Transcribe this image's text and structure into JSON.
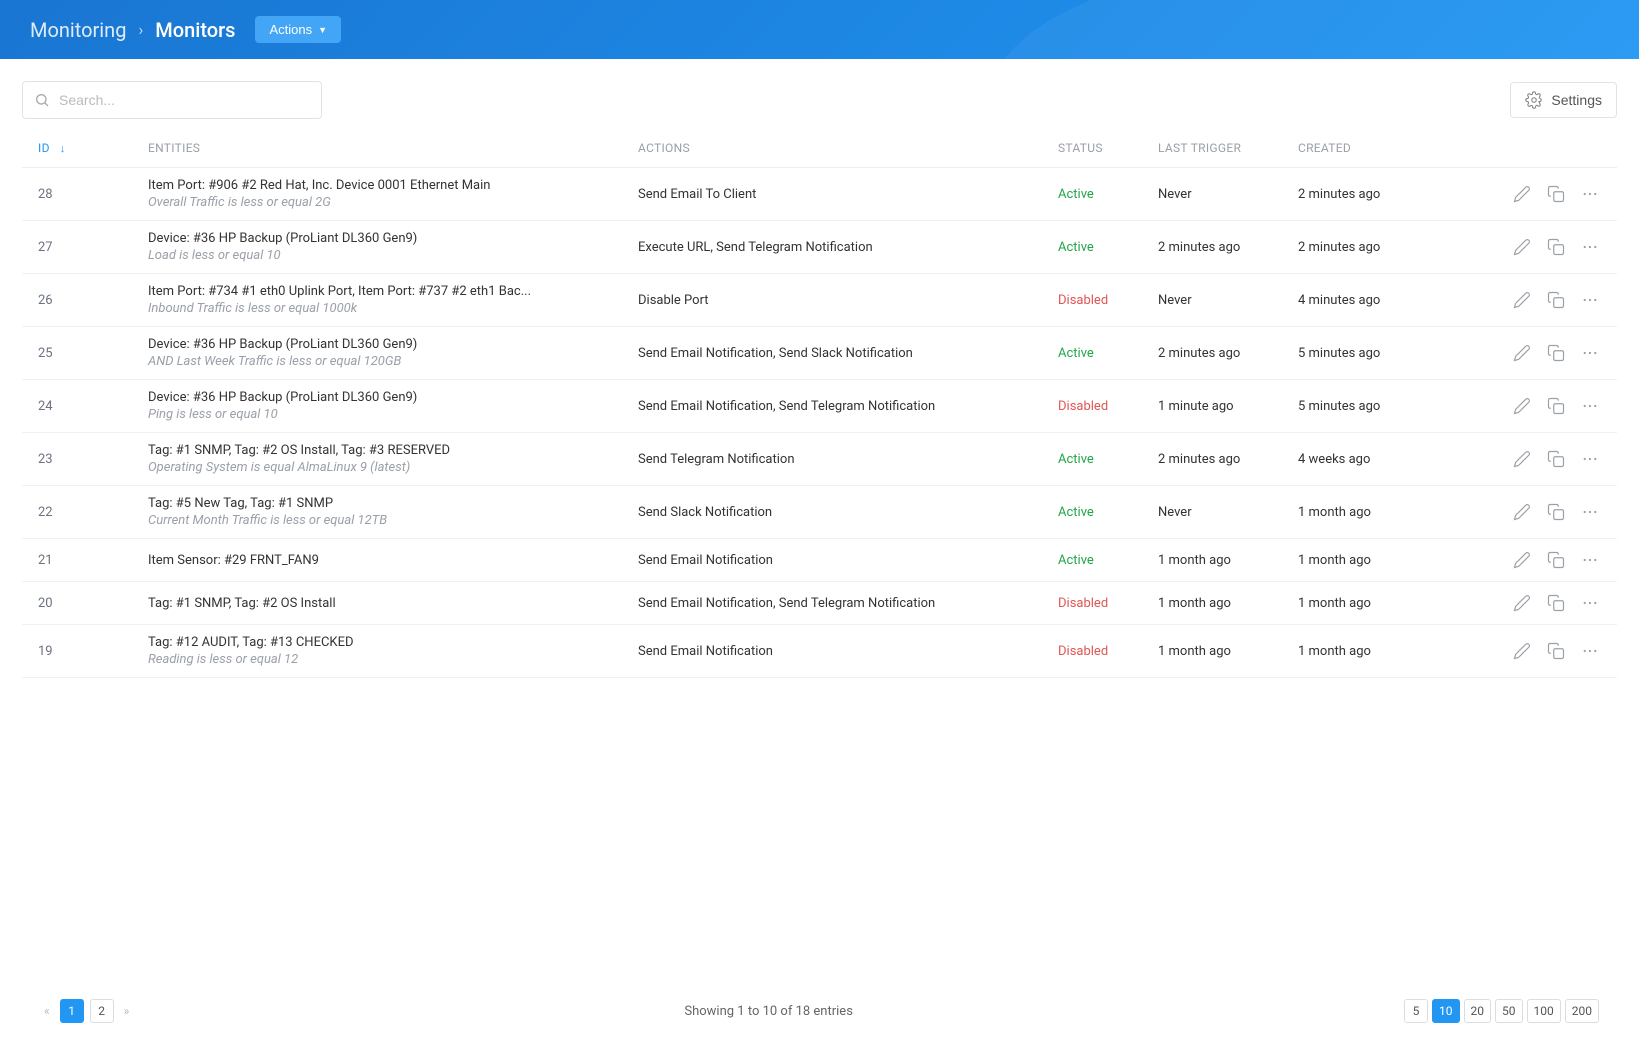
{
  "header": {
    "breadcrumb_root": "Monitoring",
    "breadcrumb_current": "Monitors",
    "actions_label": "Actions"
  },
  "toolbar": {
    "search_placeholder": "Search...",
    "settings_label": "Settings"
  },
  "columns": {
    "id": "ID",
    "entities": "ENTITIES",
    "actions": "ACTIONS",
    "status": "STATUS",
    "last_trigger": "LAST TRIGGER",
    "created": "CREATED"
  },
  "rows": [
    {
      "id": "28",
      "entities_primary": "Item Port: #906 #2 Red Hat, Inc. Device 0001 Ethernet Main",
      "entities_secondary": "Overall Traffic is less or equal 2G",
      "actions": "Send Email To Client",
      "status": "Active",
      "status_class": "status-active",
      "last_trigger": "Never",
      "created": "2 minutes ago"
    },
    {
      "id": "27",
      "entities_primary": "Device: #36 HP Backup (ProLiant DL360 Gen9)",
      "entities_secondary": "Load is less or equal 10",
      "actions": "Execute URL, Send Telegram Notification",
      "status": "Active",
      "status_class": "status-active",
      "last_trigger": "2 minutes ago",
      "created": "2 minutes ago"
    },
    {
      "id": "26",
      "entities_primary": "Item Port: #734 #1 eth0 Uplink Port, Item Port: #737 #2 eth1 Bac...",
      "entities_secondary": "Inbound Traffic is less or equal 1000k",
      "actions": "Disable Port",
      "status": "Disabled",
      "status_class": "status-disabled",
      "last_trigger": "Never",
      "created": "4 minutes ago"
    },
    {
      "id": "25",
      "entities_primary": "Device: #36 HP Backup (ProLiant DL360 Gen9)",
      "entities_secondary": "AND Last Week Traffic is less or equal 120GB",
      "actions": "Send Email Notification, Send Slack Notification",
      "status": "Active",
      "status_class": "status-active",
      "last_trigger": "2 minutes ago",
      "created": "5 minutes ago"
    },
    {
      "id": "24",
      "entities_primary": "Device: #36 HP Backup (ProLiant DL360 Gen9)",
      "entities_secondary": "Ping is less or equal 10",
      "actions": "Send Email Notification, Send Telegram Notification",
      "status": "Disabled",
      "status_class": "status-disabled",
      "last_trigger": "1 minute ago",
      "created": "5 minutes ago"
    },
    {
      "id": "23",
      "entities_primary": "Tag: #1 SNMP, Tag: #2 OS Install, Tag: #3 RESERVED",
      "entities_secondary": "Operating System is equal AlmaLinux 9 (latest)",
      "actions": "Send Telegram Notification",
      "status": "Active",
      "status_class": "status-active",
      "last_trigger": "2 minutes ago",
      "created": "4 weeks ago"
    },
    {
      "id": "22",
      "entities_primary": "Tag: #5 New Tag, Tag: #1 SNMP",
      "entities_secondary": "Current Month Traffic is less or equal 12TB",
      "actions": "Send Slack Notification",
      "status": "Active",
      "status_class": "status-active",
      "last_trigger": "Never",
      "created": "1 month ago"
    },
    {
      "id": "21",
      "entities_primary": "Item Sensor: #29 FRNT_FAN9",
      "entities_secondary": "",
      "actions": "Send Email Notification",
      "status": "Active",
      "status_class": "status-active",
      "last_trigger": "1 month ago",
      "created": "1 month ago"
    },
    {
      "id": "20",
      "entities_primary": "Tag: #1 SNMP, Tag: #2 OS Install",
      "entities_secondary": "",
      "actions": "Send Email Notification, Send Telegram Notification",
      "status": "Disabled",
      "status_class": "status-disabled",
      "last_trigger": "1 month ago",
      "created": "1 month ago"
    },
    {
      "id": "19",
      "entities_primary": "Tag: #12 AUDIT, Tag: #13 CHECKED",
      "entities_secondary": "Reading is less or equal 12",
      "actions": "Send Email Notification",
      "status": "Disabled",
      "status_class": "status-disabled",
      "last_trigger": "1 month ago",
      "created": "1 month ago"
    }
  ],
  "footer": {
    "summary": "Showing 1 to 10 of 18 entries",
    "pages": [
      "1",
      "2"
    ],
    "active_page": "1",
    "page_sizes": [
      "5",
      "10",
      "20",
      "50",
      "100",
      "200"
    ],
    "active_size": "10"
  }
}
